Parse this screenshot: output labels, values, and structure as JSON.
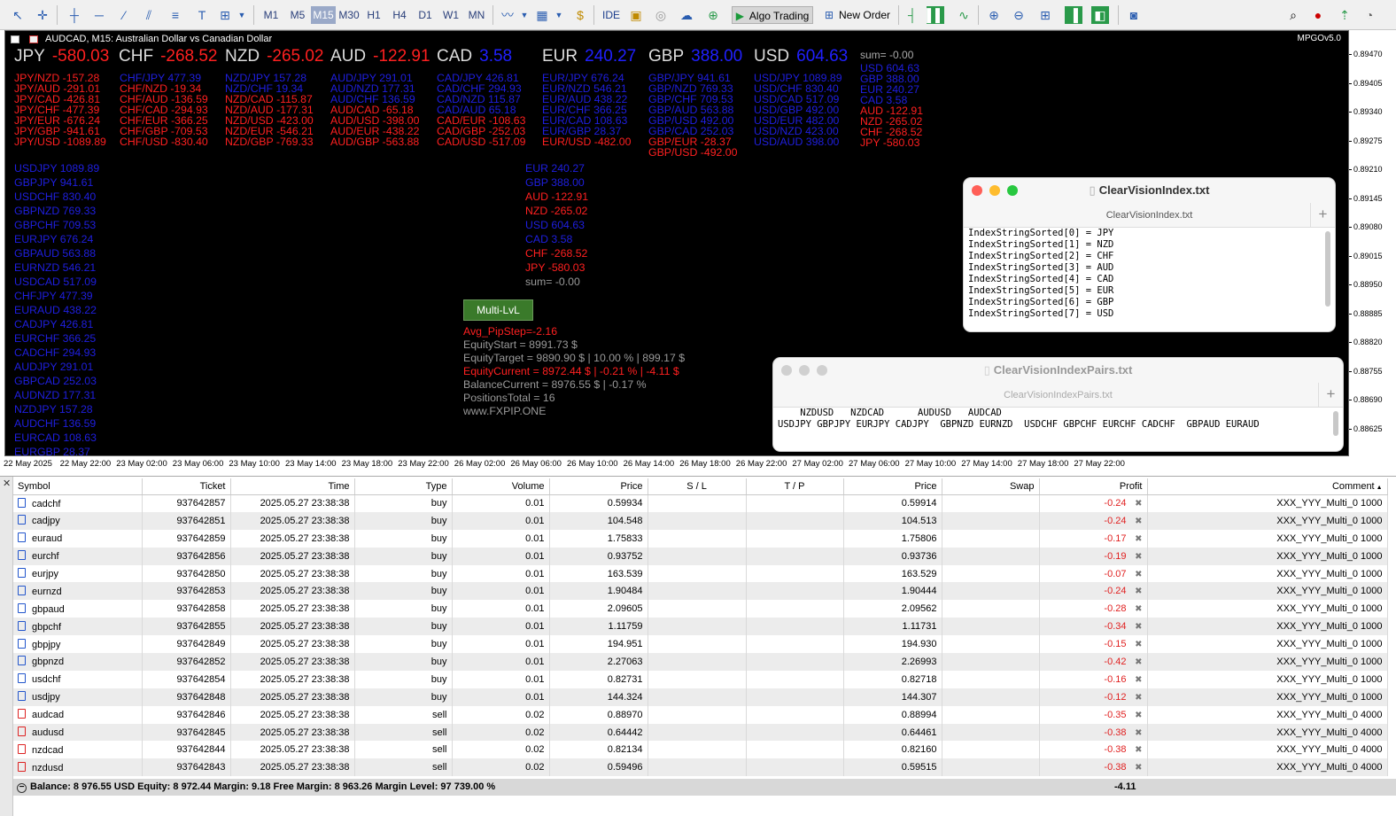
{
  "toolbar": {
    "timeframes": [
      "M1",
      "M5",
      "M15",
      "M30",
      "H1",
      "H4",
      "D1",
      "W1",
      "MN"
    ],
    "active_timeframe": "M15",
    "ide_label": "IDE",
    "algo_trading_label": "Algo Trading",
    "new_order_label": "New Order"
  },
  "chart": {
    "title": "AUDCAD, M15:  Australian Dollar vs Canadian Dollar",
    "version_label": "MPGOv5.0",
    "currencies": [
      {
        "code": "JPY",
        "value": "-580.03",
        "sign": "neg"
      },
      {
        "code": "CHF",
        "value": "-268.52",
        "sign": "neg"
      },
      {
        "code": "NZD",
        "value": "-265.02",
        "sign": "neg"
      },
      {
        "code": "AUD",
        "value": "-122.91",
        "sign": "neg"
      },
      {
        "code": "CAD",
        "value": "3.58",
        "sign": "pos"
      },
      {
        "code": "EUR",
        "value": "240.27",
        "sign": "pos"
      },
      {
        "code": "GBP",
        "value": "388.00",
        "sign": "pos"
      },
      {
        "code": "USD",
        "value": "604.63",
        "sign": "pos"
      }
    ],
    "sum_label": "sum= -0.00",
    "pair_columns": [
      [
        {
          "t": "JPY/NZD -157.28",
          "c": "r"
        },
        {
          "t": "JPY/AUD -291.01",
          "c": "r"
        },
        {
          "t": "JPY/CAD -426.81",
          "c": "r"
        },
        {
          "t": "JPY/CHF -477.39",
          "c": "r"
        },
        {
          "t": "JPY/EUR -676.24",
          "c": "r"
        },
        {
          "t": "JPY/GBP -941.61",
          "c": "r"
        },
        {
          "t": "JPY/USD -1089.89",
          "c": "r"
        }
      ],
      [
        {
          "t": "CHF/JPY  477.39",
          "c": "b"
        },
        {
          "t": "CHF/NZD -19.34",
          "c": "r"
        },
        {
          "t": "CHF/AUD -136.59",
          "c": "r"
        },
        {
          "t": "CHF/CAD -294.93",
          "c": "r"
        },
        {
          "t": "CHF/EUR -366.25",
          "c": "r"
        },
        {
          "t": "CHF/GBP -709.53",
          "c": "r"
        },
        {
          "t": "CHF/USD -830.40",
          "c": "r"
        }
      ],
      [
        {
          "t": "NZD/JPY 157.28",
          "c": "b"
        },
        {
          "t": "NZD/CHF 19.34",
          "c": "b"
        },
        {
          "t": "NZD/CAD -115.87",
          "c": "r"
        },
        {
          "t": "NZD/AUD -177.31",
          "c": "r"
        },
        {
          "t": "NZD/USD -423.00",
          "c": "r"
        },
        {
          "t": "NZD/EUR -546.21",
          "c": "r"
        },
        {
          "t": "NZD/GBP -769.33",
          "c": "r"
        }
      ],
      [
        {
          "t": "AUD/JPY 291.01",
          "c": "b"
        },
        {
          "t": "AUD/NZD 177.31",
          "c": "b"
        },
        {
          "t": "AUD/CHF 136.59",
          "c": "b"
        },
        {
          "t": "AUD/CAD -65.18",
          "c": "r"
        },
        {
          "t": "AUD/USD -398.00",
          "c": "r"
        },
        {
          "t": "AUD/EUR -438.22",
          "c": "r"
        },
        {
          "t": "AUD/GBP -563.88",
          "c": "r"
        }
      ],
      [
        {
          "t": "CAD/JPY  426.81",
          "c": "b"
        },
        {
          "t": "CAD/CHF 294.93",
          "c": "b"
        },
        {
          "t": "CAD/NZD 115.87",
          "c": "b"
        },
        {
          "t": "CAD/AUD 65.18",
          "c": "b"
        },
        {
          "t": "CAD/EUR -108.63",
          "c": "r"
        },
        {
          "t": "CAD/GBP -252.03",
          "c": "r"
        },
        {
          "t": "CAD/USD -517.09",
          "c": "r"
        }
      ],
      [
        {
          "t": "EUR/JPY 676.24",
          "c": "b"
        },
        {
          "t": "EUR/NZD 546.21",
          "c": "b"
        },
        {
          "t": "EUR/AUD 438.22",
          "c": "b"
        },
        {
          "t": "EUR/CHF 366.25",
          "c": "b"
        },
        {
          "t": "EUR/CAD 108.63",
          "c": "b"
        },
        {
          "t": "EUR/GBP 28.37",
          "c": "b"
        },
        {
          "t": "EUR/USD -482.00",
          "c": "r"
        }
      ],
      [
        {
          "t": "GBP/JPY 941.61",
          "c": "b"
        },
        {
          "t": "GBP/NZD 769.33",
          "c": "b"
        },
        {
          "t": "GBP/CHF 709.53",
          "c": "b"
        },
        {
          "t": "GBP/AUD 563.88",
          "c": "b"
        },
        {
          "t": "GBP/USD 492.00",
          "c": "b"
        },
        {
          "t": "GBP/CAD 252.03",
          "c": "b"
        },
        {
          "t": "GBP/EUR -28.37",
          "c": "r"
        },
        {
          "t": "GBP/USD -492.00",
          "c": "r"
        }
      ],
      [
        {
          "t": "USD/JPY 1089.89",
          "c": "b"
        },
        {
          "t": "USD/CHF 830.40",
          "c": "b"
        },
        {
          "t": "USD/CAD 517.09",
          "c": "b"
        },
        {
          "t": "USD/GBP 492.00",
          "c": "b"
        },
        {
          "t": "USD/EUR 482.00",
          "c": "b"
        },
        {
          "t": "USD/NZD 423.00",
          "c": "b"
        },
        {
          "t": "USD/AUD 398.00",
          "c": "b"
        }
      ],
      [
        {
          "t": "USD 604.63",
          "c": "b"
        },
        {
          "t": "GBP 388.00",
          "c": "b"
        },
        {
          "t": "EUR 240.27",
          "c": "b"
        },
        {
          "t": "CAD 3.58",
          "c": "b"
        },
        {
          "t": "AUD -122.91",
          "c": "r"
        },
        {
          "t": "NZD -265.02",
          "c": "r"
        },
        {
          "t": "CHF -268.52",
          "c": "r"
        },
        {
          "t": "JPY -580.03",
          "c": "r"
        }
      ]
    ],
    "pair_list": [
      {
        "t": "USDJPY 1089.89",
        "c": "b"
      },
      {
        "t": "GBPJPY 941.61",
        "c": "b"
      },
      {
        "t": "USDCHF 830.40",
        "c": "b"
      },
      {
        "t": "GBPNZD 769.33",
        "c": "b"
      },
      {
        "t": "GBPCHF 709.53",
        "c": "b"
      },
      {
        "t": "EURJPY 676.24",
        "c": "b"
      },
      {
        "t": "GBPAUD 563.88",
        "c": "b"
      },
      {
        "t": "EURNZD 546.21",
        "c": "b"
      },
      {
        "t": "USDCAD 517.09",
        "c": "b"
      },
      {
        "t": "CHFJPY 477.39",
        "c": "b"
      },
      {
        "t": "EURAUD 438.22",
        "c": "b"
      },
      {
        "t": "CADJPY 426.81",
        "c": "b"
      },
      {
        "t": "EURCHF 366.25",
        "c": "b"
      },
      {
        "t": "CADCHF 294.93",
        "c": "b"
      },
      {
        "t": "AUDJPY 291.01",
        "c": "b"
      },
      {
        "t": "GBPCAD 252.03",
        "c": "b"
      },
      {
        "t": "AUDNZD 177.31",
        "c": "b"
      },
      {
        "t": "NZDJPY 157.28",
        "c": "b"
      },
      {
        "t": "AUDCHF 136.59",
        "c": "b"
      },
      {
        "t": "EURCAD 108.63",
        "c": "b"
      },
      {
        "t": "EURGBP 28.37",
        "c": "b"
      }
    ],
    "ccy_list": [
      {
        "t": "EUR 240.27",
        "c": "b"
      },
      {
        "t": "GBP 388.00",
        "c": "b"
      },
      {
        "t": "AUD -122.91",
        "c": "r"
      },
      {
        "t": "NZD -265.02",
        "c": "r"
      },
      {
        "t": "USD 604.63",
        "c": "b"
      },
      {
        "t": "CAD 3.58",
        "c": "b"
      },
      {
        "t": "CHF -268.52",
        "c": "r"
      },
      {
        "t": "JPY -580.03",
        "c": "r"
      },
      {
        "t": "sum= -0.00",
        "c": "g"
      }
    ],
    "multi_button_label": "Multi-LvL",
    "stats": [
      {
        "t": "Avg_PipStep=-2.16",
        "c": "r"
      },
      {
        "t": "EquityStart       = 8991.73 $",
        "c": "g"
      },
      {
        "t": "EquityTarget     = 9890.90 $ | 10.00 % | 899.17 $",
        "c": "g"
      },
      {
        "t": "EquityCurrent    = 8972.44 $ | -0.21 % | -4.11 $",
        "c": "r"
      },
      {
        "t": "BalanceCurrent  = 8976.55 $ | -0.17 %",
        "c": "g"
      },
      {
        "t": "PositionsTotal    = 16",
        "c": "g"
      },
      {
        "t": "www.FXPIP.ONE",
        "c": "g"
      }
    ],
    "price_axis": [
      "0.89470",
      "0.89405",
      "0.89340",
      "0.89275",
      "0.89210",
      "0.89145",
      "0.89080",
      "0.89015",
      "0.88950",
      "0.88885",
      "0.88820",
      "0.88755",
      "0.88690",
      "0.88625"
    ],
    "time_axis": [
      "22 May 2025",
      "22 May 22:00",
      "23 May 02:00",
      "23 May 06:00",
      "23 May 10:00",
      "23 May 14:00",
      "23 May 18:00",
      "23 May 22:00",
      "26 May 02:00",
      "26 May 06:00",
      "26 May 10:00",
      "26 May 14:00",
      "26 May 18:00",
      "26 May 22:00",
      "27 May 02:00",
      "27 May 06:00",
      "27 May 10:00",
      "27 May 14:00",
      "27 May 18:00",
      "27 May 22:00"
    ]
  },
  "window_index": {
    "title": "ClearVisionIndex.txt",
    "tab": "ClearVisionIndex.txt",
    "lines": "IndexStringSorted[0] = JPY\nIndexStringSorted[1] = NZD\nIndexStringSorted[2] = CHF\nIndexStringSorted[3] = AUD\nIndexStringSorted[4] = CAD\nIndexStringSorted[5] = EUR\nIndexStringSorted[6] = GBP\nIndexStringSorted[7] = USD"
  },
  "window_pairs": {
    "title": "ClearVisionIndexPairs.txt",
    "tab": "ClearVisionIndexPairs.txt",
    "lines": "    NZDUSD   NZDCAD      AUDUSD   AUDCAD\nUSDJPY GBPJPY EURJPY CADJPY  GBPNZD EURNZD  USDCHF GBPCHF EURCHF CADCHF  GBPAUD EURAUD"
  },
  "trade": {
    "columns": [
      "Symbol",
      "Ticket",
      "Time",
      "Type",
      "Volume",
      "Price",
      "S / L",
      "T / P",
      "Price",
      "Swap",
      "Profit",
      "Comment"
    ],
    "rows": [
      [
        "cadchf",
        "937642857",
        "2025.05.27 23:38:38",
        "buy",
        "0.01",
        "0.59934",
        "",
        "",
        "0.59914",
        "",
        "-0.24",
        "XXX_YYY_Multi_0 1000"
      ],
      [
        "cadjpy",
        "937642851",
        "2025.05.27 23:38:38",
        "buy",
        "0.01",
        "104.548",
        "",
        "",
        "104.513",
        "",
        "-0.24",
        "XXX_YYY_Multi_0 1000"
      ],
      [
        "euraud",
        "937642859",
        "2025.05.27 23:38:38",
        "buy",
        "0.01",
        "1.75833",
        "",
        "",
        "1.75806",
        "",
        "-0.17",
        "XXX_YYY_Multi_0 1000"
      ],
      [
        "eurchf",
        "937642856",
        "2025.05.27 23:38:38",
        "buy",
        "0.01",
        "0.93752",
        "",
        "",
        "0.93736",
        "",
        "-0.19",
        "XXX_YYY_Multi_0 1000"
      ],
      [
        "eurjpy",
        "937642850",
        "2025.05.27 23:38:38",
        "buy",
        "0.01",
        "163.539",
        "",
        "",
        "163.529",
        "",
        "-0.07",
        "XXX_YYY_Multi_0 1000"
      ],
      [
        "eurnzd",
        "937642853",
        "2025.05.27 23:38:38",
        "buy",
        "0.01",
        "1.90484",
        "",
        "",
        "1.90444",
        "",
        "-0.24",
        "XXX_YYY_Multi_0 1000"
      ],
      [
        "gbpaud",
        "937642858",
        "2025.05.27 23:38:38",
        "buy",
        "0.01",
        "2.09605",
        "",
        "",
        "2.09562",
        "",
        "-0.28",
        "XXX_YYY_Multi_0 1000"
      ],
      [
        "gbpchf",
        "937642855",
        "2025.05.27 23:38:38",
        "buy",
        "0.01",
        "1.11759",
        "",
        "",
        "1.11731",
        "",
        "-0.34",
        "XXX_YYY_Multi_0 1000"
      ],
      [
        "gbpjpy",
        "937642849",
        "2025.05.27 23:38:38",
        "buy",
        "0.01",
        "194.951",
        "",
        "",
        "194.930",
        "",
        "-0.15",
        "XXX_YYY_Multi_0 1000"
      ],
      [
        "gbpnzd",
        "937642852",
        "2025.05.27 23:38:38",
        "buy",
        "0.01",
        "2.27063",
        "",
        "",
        "2.26993",
        "",
        "-0.42",
        "XXX_YYY_Multi_0 1000"
      ],
      [
        "usdchf",
        "937642854",
        "2025.05.27 23:38:38",
        "buy",
        "0.01",
        "0.82731",
        "",
        "",
        "0.82718",
        "",
        "-0.16",
        "XXX_YYY_Multi_0 1000"
      ],
      [
        "usdjpy",
        "937642848",
        "2025.05.27 23:38:38",
        "buy",
        "0.01",
        "144.324",
        "",
        "",
        "144.307",
        "",
        "-0.12",
        "XXX_YYY_Multi_0 1000"
      ],
      [
        "audcad",
        "937642846",
        "2025.05.27 23:38:38",
        "sell",
        "0.02",
        "0.88970",
        "",
        "",
        "0.88994",
        "",
        "-0.35",
        "XXX_YYY_Multi_0 4000"
      ],
      [
        "audusd",
        "937642845",
        "2025.05.27 23:38:38",
        "sell",
        "0.02",
        "0.64442",
        "",
        "",
        "0.64461",
        "",
        "-0.38",
        "XXX_YYY_Multi_0 4000"
      ],
      [
        "nzdcad",
        "937642844",
        "2025.05.27 23:38:38",
        "sell",
        "0.02",
        "0.82134",
        "",
        "",
        "0.82160",
        "",
        "-0.38",
        "XXX_YYY_Multi_0 4000"
      ],
      [
        "nzdusd",
        "937642843",
        "2025.05.27 23:38:38",
        "sell",
        "0.02",
        "0.59496",
        "",
        "",
        "0.59515",
        "",
        "-0.38",
        "XXX_YYY_Multi_0 4000"
      ]
    ],
    "summary": "Balance: 8 976.55 USD  Equity: 8 972.44  Margin: 9.18  Free Margin: 8 963.26  Margin Level: 97 739.00 %",
    "total_profit": "-4.11"
  }
}
